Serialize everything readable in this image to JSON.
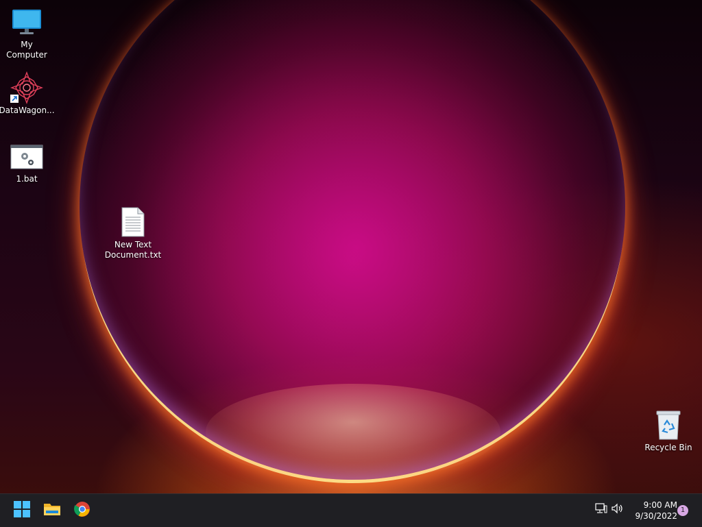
{
  "desktop": {
    "icons": [
      {
        "label": "My Computer",
        "icon": "monitor-icon"
      },
      {
        "label": "DataWagon...",
        "icon": "datawagon-shortcut-icon"
      },
      {
        "label": "1.bat",
        "icon": "batch-file-icon"
      },
      {
        "label": "New Text\nDocument.txt",
        "icon": "text-file-icon"
      },
      {
        "label": "Recycle Bin",
        "icon": "recycle-bin-icon"
      }
    ]
  },
  "taskbar": {
    "apps": [
      {
        "name": "Start",
        "icon": "windows-start-icon"
      },
      {
        "name": "File Explorer",
        "icon": "file-explorer-icon"
      },
      {
        "name": "Google Chrome",
        "icon": "chrome-icon"
      }
    ],
    "tray": {
      "network_icon": "network-icon",
      "volume_icon": "volume-icon"
    },
    "clock": {
      "time": "9:00 AM",
      "date": "9/30/2022"
    },
    "notification_count": "1"
  },
  "colors": {
    "taskbar_bg": "#1f1f23",
    "accent": "#0078d4",
    "notification_badge": "#d8a8e4"
  }
}
